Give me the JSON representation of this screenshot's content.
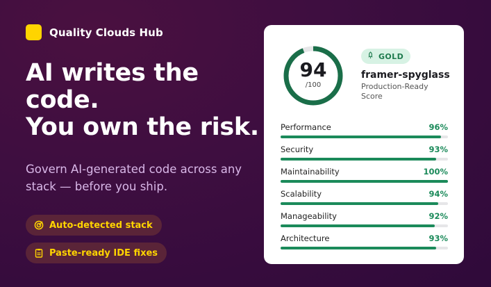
{
  "brand": {
    "name": "Quality Clouds Hub"
  },
  "hero": {
    "lines": [
      "AI writes the",
      "code.",
      "You own the risk."
    ]
  },
  "subtitle": "Govern AI-generated code across any stack — before you ship.",
  "pills": [
    {
      "label": "Auto-detected stack",
      "icon": "radar-icon"
    },
    {
      "label": "Paste-ready IDE fixes",
      "icon": "clipboard-icon"
    }
  ],
  "card": {
    "score": "94",
    "score_max": "/100",
    "score_fraction": 0.94,
    "badge": {
      "label": "GOLD",
      "icon": "rocket-icon"
    },
    "project_name": "framer-spyglass",
    "score_label": "Production-Ready Score",
    "metrics": [
      {
        "name": "Performance",
        "value": "96%",
        "fraction": 0.96
      },
      {
        "name": "Security",
        "value": "93%",
        "fraction": 0.93
      },
      {
        "name": "Maintainability",
        "value": "100%",
        "fraction": 1.0
      },
      {
        "name": "Scalability",
        "value": "94%",
        "fraction": 0.94
      },
      {
        "name": "Manageability",
        "value": "92%",
        "fraction": 0.92
      },
      {
        "name": "Architecture",
        "value": "93%",
        "fraction": 0.93
      }
    ]
  },
  "colors": {
    "accent": "#ffd400",
    "success": "#1b8a5a",
    "background": "#3e0e40"
  }
}
